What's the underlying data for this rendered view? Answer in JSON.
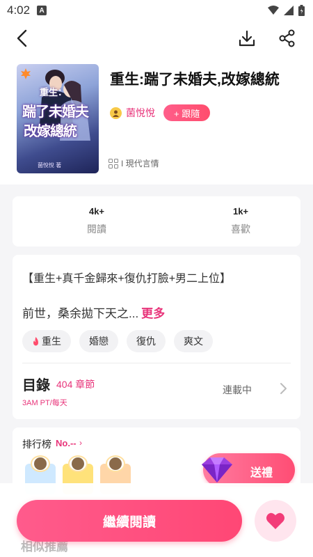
{
  "status_bar": {
    "time": "4:02",
    "app_badge": "A"
  },
  "book": {
    "title": "重生:踹了未婚夫,改嫁總統",
    "cover": {
      "sub": "重生：",
      "line1": "踹了未婚夫",
      "line2": "改嫁總統",
      "author": "菌悅悅 著"
    },
    "author": "菌悅悅",
    "follow_label": "+ 跟隨",
    "genre": "I 現代言情"
  },
  "stats": [
    {
      "value": "4k+",
      "label": "閱讀"
    },
    {
      "value": "1k+",
      "label": "喜歡"
    }
  ],
  "detail": {
    "tagline": "【重生+真千金歸來+復仇打臉+男二上位】",
    "synopsis": "前世，桑余拋下天之...",
    "more_label": "更多",
    "tags": [
      "重生",
      "婚戀",
      "復仇",
      "爽文"
    ]
  },
  "toc": {
    "title": "目錄",
    "count": "404 章節",
    "schedule": "3AM PT/每天",
    "status": "連載中"
  },
  "ranking": {
    "label": "排行榜",
    "rank": "No.--",
    "gift_label": "送禮"
  },
  "actions": {
    "continue_label": "繼續閱讀"
  },
  "similar": {
    "title": "相似推薦"
  },
  "colors": {
    "accent": "#e8347a",
    "button": "#ff4d74",
    "fav_bg": "#ffe5ee"
  },
  "icons": [
    "back-arrow-icon",
    "download-icon",
    "share-icon",
    "fire-icon",
    "chevron-right-icon",
    "heart-icon",
    "gem-icon",
    "wifi-icon",
    "signal-icon",
    "battery-icon"
  ]
}
